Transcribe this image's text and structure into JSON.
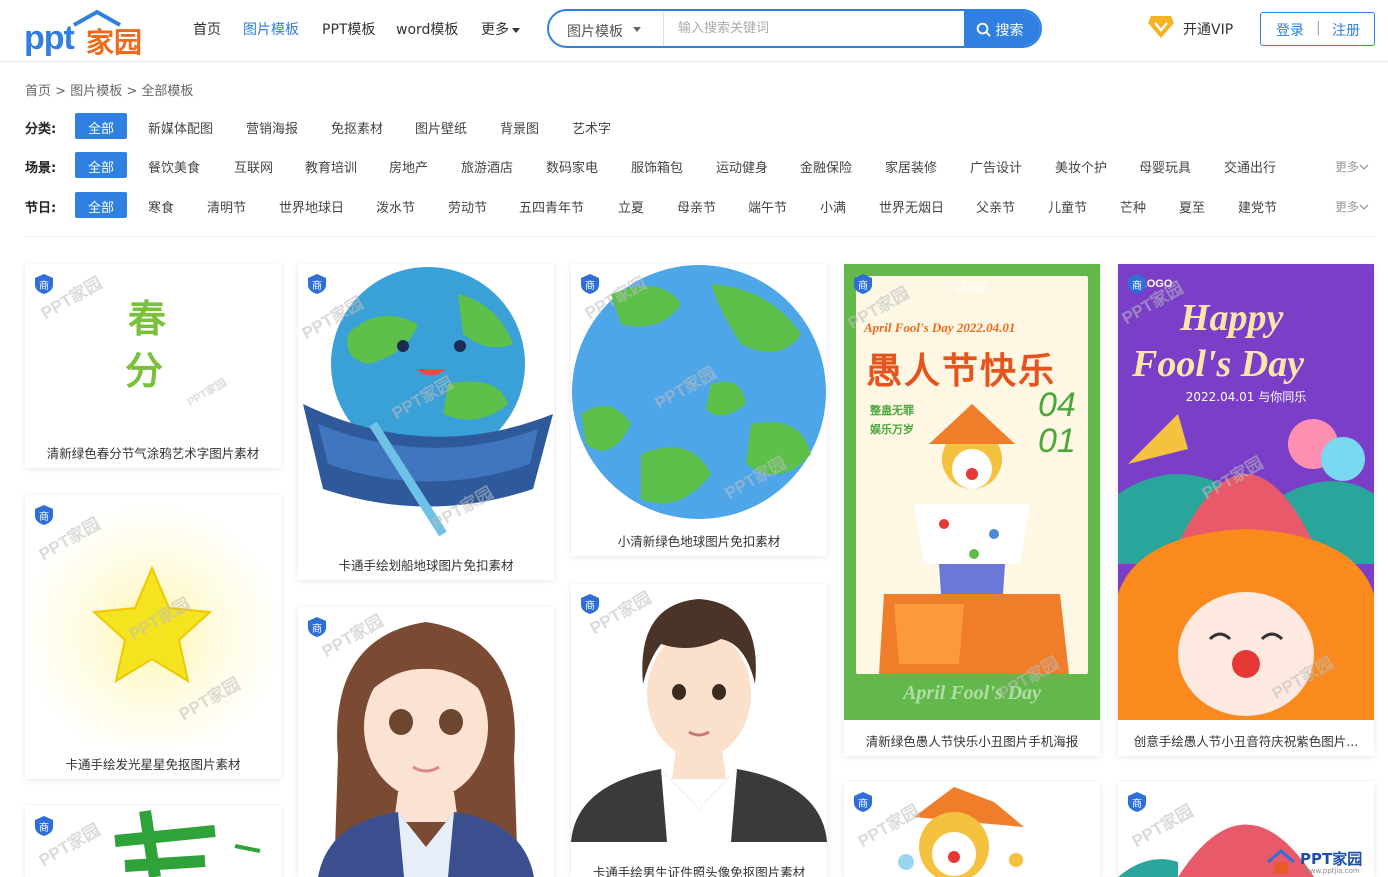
{
  "header": {
    "logo_ppt": "ppt",
    "logo_cn": "家园",
    "nav": [
      {
        "label": "首页"
      },
      {
        "label": "图片模板"
      },
      {
        "label": "PPT模板"
      },
      {
        "label": "word模板"
      },
      {
        "label": "更多"
      }
    ],
    "search": {
      "category": "图片模板",
      "placeholder": "输入搜索关键词",
      "button": "搜索"
    },
    "vip": "开通VIP",
    "login": "登录",
    "sep": "|",
    "register": "注册"
  },
  "breadcrumb": [
    "首页",
    ">",
    "图片模板",
    ">",
    "全部模板"
  ],
  "filters": {
    "category": {
      "label": "分类:",
      "items": [
        "全部",
        "新媒体配图",
        "营销海报",
        "免抠素材",
        "图片壁纸",
        "背景图",
        "艺术字"
      ]
    },
    "scene": {
      "label": "场景:",
      "items": [
        "全部",
        "餐饮美食",
        "互联网",
        "教育培训",
        "房地产",
        "旅游酒店",
        "数码家电",
        "服饰箱包",
        "运动健身",
        "金融保险",
        "家居装修",
        "广告设计",
        "美妆个护",
        "母婴玩具",
        "交通出行"
      ],
      "more": "更多"
    },
    "festival": {
      "label": "节日:",
      "items": [
        "全部",
        "寒食",
        "清明节",
        "世界地球日",
        "泼水节",
        "劳动节",
        "五四青年节",
        "立夏",
        "母亲节",
        "端午节",
        "小满",
        "世界无烟日",
        "父亲节",
        "儿童节",
        "芒种",
        "夏至",
        "建党节"
      ],
      "more": "更多"
    }
  },
  "badge": "商",
  "watermark": "PPT家园",
  "cards": [
    {
      "caption": "清新绿色春分节气涂鸦艺术字图片素材",
      "art": {
        "line1": "春",
        "line2": "分"
      }
    },
    {
      "caption": "卡通手绘发光星星免抠图片素材"
    },
    {
      "caption": ""
    },
    {
      "caption": "卡通手绘划船地球图片免扣素材"
    },
    {
      "caption": ""
    },
    {
      "caption": "小清新绿色地球图片免扣素材"
    },
    {
      "caption": "卡通手绘男生证件照头像免抠图片素材"
    },
    {
      "caption": "清新绿色愚人节快乐小丑图片手机海报",
      "art": {
        "logo": "LOGO",
        "date": "April Fool's Day 2022.04.01",
        "title": "愚人节快乐",
        "sub1": "整蛊无罪",
        "sub2": "娱乐万岁",
        "num1": "04",
        "num2": "01",
        "foot": "April Fool's Day"
      }
    },
    {
      "caption": ""
    },
    {
      "caption": "创意手绘愚人节小丑音符庆祝紫色图片...",
      "art": {
        "logo": "LOGO",
        "line1": "Happy",
        "line2": "Fool's Day",
        "date": "2022.04.01 与你同乐"
      }
    },
    {
      "caption": ""
    }
  ],
  "corner_logo": {
    "text": "PPT家园",
    "url": "www.pptjia.com"
  },
  "colors": {
    "accent": "#2f80e0",
    "logo_orange": "#f06a1a",
    "poster_green": "#62b84a",
    "poster_purple": "#7a3ec9"
  }
}
